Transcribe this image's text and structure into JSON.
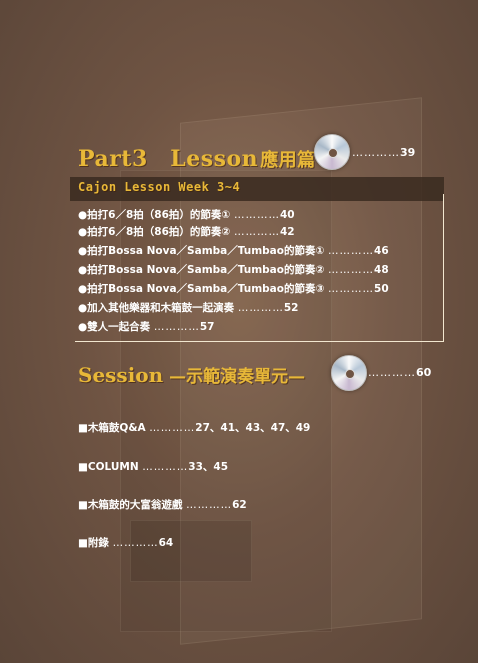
{
  "part3": {
    "title": "Part3　Lesson",
    "subtitle": "應用篇",
    "icon": "cd-disc-icon",
    "dots": "…………",
    "page": "39"
  },
  "week": {
    "title": "Cajon Lesson Week 3~4",
    "items": [
      {
        "text": "●拍打6／8拍（86拍）的節奏①",
        "dots": "…………",
        "page": "40"
      },
      {
        "text": "●拍打6／8拍（86拍）的節奏②",
        "dots": "…………",
        "page": "42"
      },
      {
        "text": "●拍打Bossa Nova／Samba／Tumbao的節奏①",
        "dots": "…………",
        "page": "46"
      },
      {
        "text": "●拍打Bossa Nova／Samba／Tumbao的節奏②",
        "dots": "…………",
        "page": "48"
      },
      {
        "text": "●拍打Bossa Nova／Samba／Tumbao的節奏③",
        "dots": "…………",
        "page": "50"
      },
      {
        "text": "●加入其他樂器和木箱鼓一起演奏",
        "dots": "…………",
        "page": "52"
      },
      {
        "text": "●雙人一起合奏",
        "dots": "…………",
        "page": "57"
      }
    ]
  },
  "session": {
    "title": "Session",
    "subtitle": "—示範演奏單元—",
    "icon": "cd-disc-icon",
    "dots": "…………",
    "page": "60"
  },
  "extras": [
    {
      "text": "■木箱鼓Q&A",
      "dots": "…………",
      "page": "27、41、43、47、49"
    },
    {
      "text": "■COLUMN",
      "dots": "…………",
      "page": "33、45"
    },
    {
      "text": "■木箱鼓的大富翁遊戲",
      "dots": "…………",
      "page": "62"
    },
    {
      "text": "■附錄",
      "dots": "…………",
      "page": "64"
    }
  ],
  "colors": {
    "accent": "#e8b838",
    "text": "#ffffff",
    "background": "#6f5443"
  }
}
